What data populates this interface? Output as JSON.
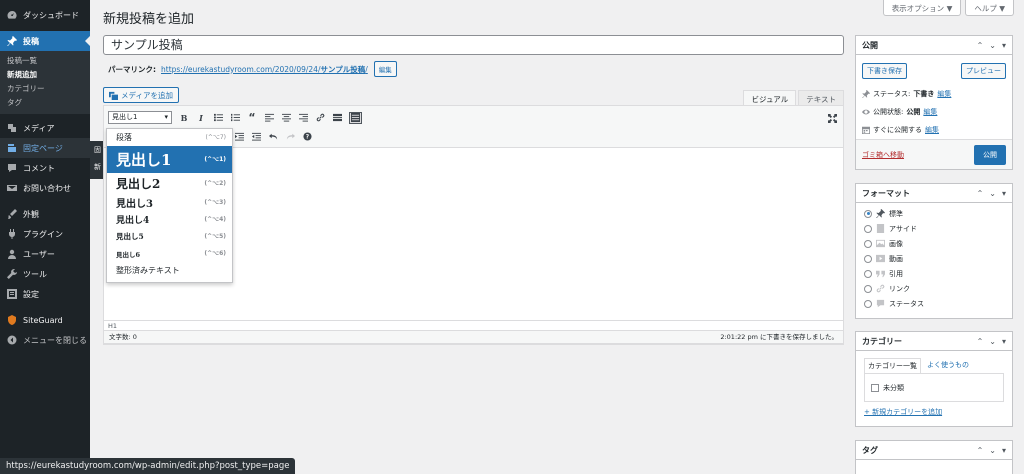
{
  "sidebar": {
    "dashboard": "ダッシュボード",
    "posts": "投稿",
    "posts_sub": [
      "投稿一覧",
      "新規追加",
      "カテゴリー",
      "タグ"
    ],
    "media": "メディア",
    "pages": "固定ページ",
    "comments": "コメント",
    "contact": "お問い合わせ",
    "appearance": "外観",
    "plugins": "プラグイン",
    "users": "ユーザー",
    "tools": "ツール",
    "settings": "設定",
    "siteguard": "SiteGuard",
    "collapse": "メニューを閉じる",
    "flyout": [
      "固",
      "新"
    ]
  },
  "screen_meta": {
    "options": "表示オプション ▼",
    "help": "ヘルプ ▼"
  },
  "page_title": "新規投稿を追加",
  "post_title": "サンプル投稿",
  "permalink": {
    "label": "パーマリンク:",
    "base": "https://eurekastudyroom.com/2020/09/24/",
    "slug": "サンプル投稿",
    "slash": "/",
    "edit": "編集"
  },
  "media_button": "メディアを追加",
  "editor_tabs": {
    "visual": "ビジュアル",
    "text": "テキスト"
  },
  "format_select": "見出し1",
  "format_menu": [
    {
      "label": "段落",
      "shortcut": "(^⌥7)"
    },
    {
      "label": "見出し1",
      "shortcut": "(^⌥1)"
    },
    {
      "label": "見出し2",
      "shortcut": "(^⌥2)"
    },
    {
      "label": "見出し3",
      "shortcut": "(^⌥3)"
    },
    {
      "label": "見出し4",
      "shortcut": "(^⌥4)"
    },
    {
      "label": "見出し5",
      "shortcut": "(^⌥5)"
    },
    {
      "label": "見出し6",
      "shortcut": "(^⌥6)"
    },
    {
      "label": "整形済みテキスト",
      "shortcut": ""
    }
  ],
  "editor_status": {
    "path": "H1",
    "wordcount": "文字数: 0",
    "saved": "2:01:22 pm に下書きを保存しました。"
  },
  "publish": {
    "title": "公開",
    "save_draft": "下書き保存",
    "preview": "プレビュー",
    "status_label": "ステータス:",
    "status_value": "下書き",
    "visibility_label": "公開状態:",
    "visibility_value": "公開",
    "schedule": "すぐに公開する",
    "edit": "編集",
    "trash": "ゴミ箱へ移動",
    "publish_btn": "公開"
  },
  "format_box": {
    "title": "フォーマット",
    "options": [
      "標準",
      "アサイド",
      "画像",
      "動画",
      "引用",
      "リンク",
      "ステータス"
    ]
  },
  "category_box": {
    "title": "カテゴリー",
    "tab_all": "カテゴリー一覧",
    "tab_popular": "よく使うもの",
    "item": "未分類",
    "add_new": "+ 新規カテゴリーを追加"
  },
  "tag_box": {
    "title": "タグ"
  },
  "status_url": "https://eurekastudyroom.com/wp-admin/edit.php?post_type=page"
}
